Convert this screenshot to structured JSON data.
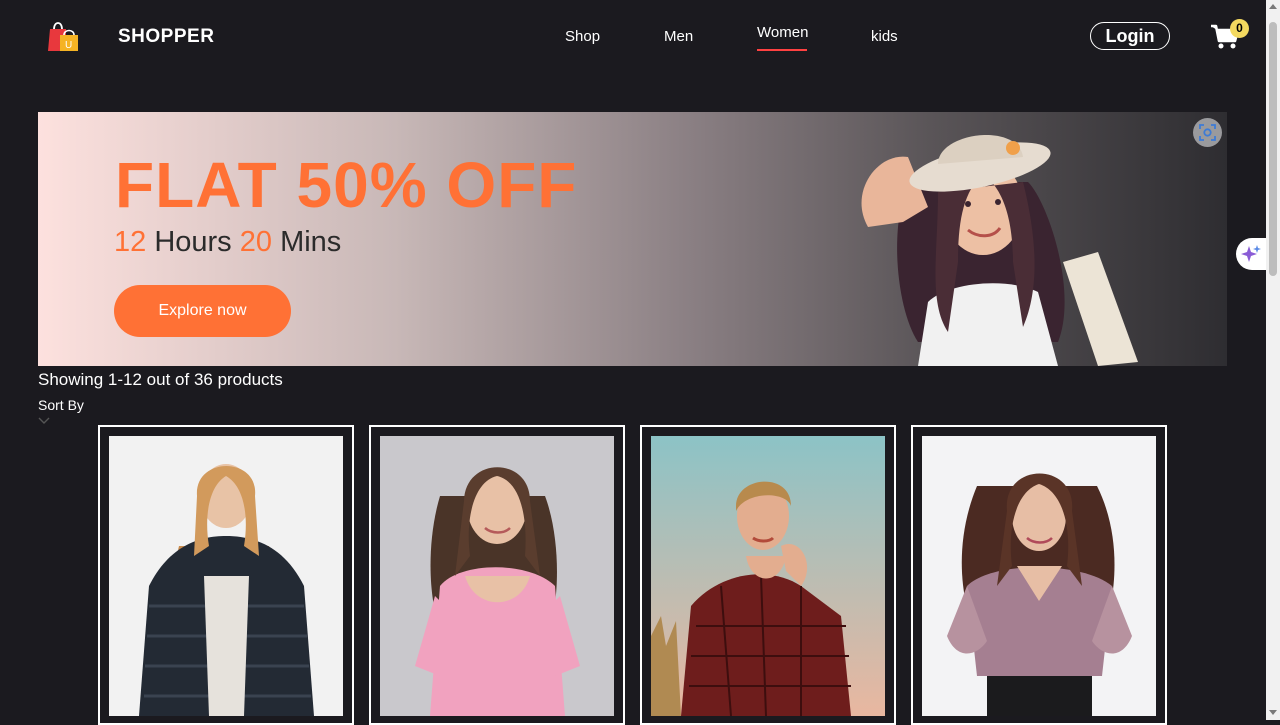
{
  "brand": {
    "name": "SHOPPER",
    "logo_icon": "shopping-bags-icon",
    "logo_letter": "U"
  },
  "nav": {
    "links": [
      {
        "label": "Shop",
        "active": false
      },
      {
        "label": "Men",
        "active": false
      },
      {
        "label": "Women",
        "active": true
      },
      {
        "label": "kids",
        "active": false
      }
    ],
    "login_label": "Login",
    "cart_icon": "cart-icon",
    "cart_count": "0"
  },
  "banner": {
    "title": "FLAT 50% OFF",
    "hours_value": "12",
    "hours_label": "Hours",
    "mins_value": "20",
    "mins_label": "Mins",
    "cta_label": "Explore now",
    "accent_color": "#ff7135",
    "lens_icon": "visual-search-icon"
  },
  "listing": {
    "showing_text": "Showing 1-12 out of 36 products",
    "sort_label": "Sort By",
    "sort_icon": "chevron-down-icon"
  },
  "products": [
    {
      "image": "woman in black fur jacket"
    },
    {
      "image": "woman in pink top"
    },
    {
      "image": "woman in red checked wrap top"
    },
    {
      "image": "woman in mauve puff-sleeve top"
    }
  ],
  "colors": {
    "page_bg": "#1b1a1f",
    "accent": "#ff7135",
    "nav_active_underline": "#ff4141",
    "cart_badge": "#f4d95f"
  }
}
